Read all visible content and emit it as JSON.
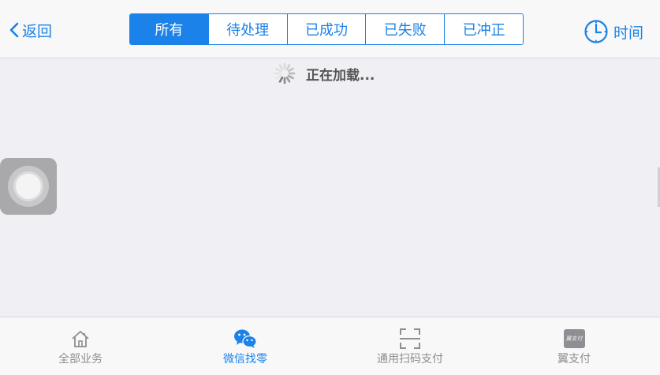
{
  "header": {
    "back_label": "返回",
    "tabs": [
      {
        "label": "所有",
        "active": true
      },
      {
        "label": "待处理",
        "active": false
      },
      {
        "label": "已成功",
        "active": false
      },
      {
        "label": "已失败",
        "active": false
      },
      {
        "label": "已冲正",
        "active": false
      }
    ],
    "time_label": "时间"
  },
  "main": {
    "loading_text": "正在加载..."
  },
  "tabbar": {
    "items": [
      {
        "label": "全部业务",
        "icon": "home-icon"
      },
      {
        "label": "微信找零",
        "icon": "wechat-icon"
      },
      {
        "label": "通用扫码支付",
        "icon": "scan-icon"
      },
      {
        "label": "翼支付",
        "icon": "yizhifu-icon",
        "icon_text": "翼支付"
      }
    ]
  },
  "colors": {
    "accent": "#1a82e8",
    "inactive": "#8e8e93",
    "background": "#efeff4"
  }
}
